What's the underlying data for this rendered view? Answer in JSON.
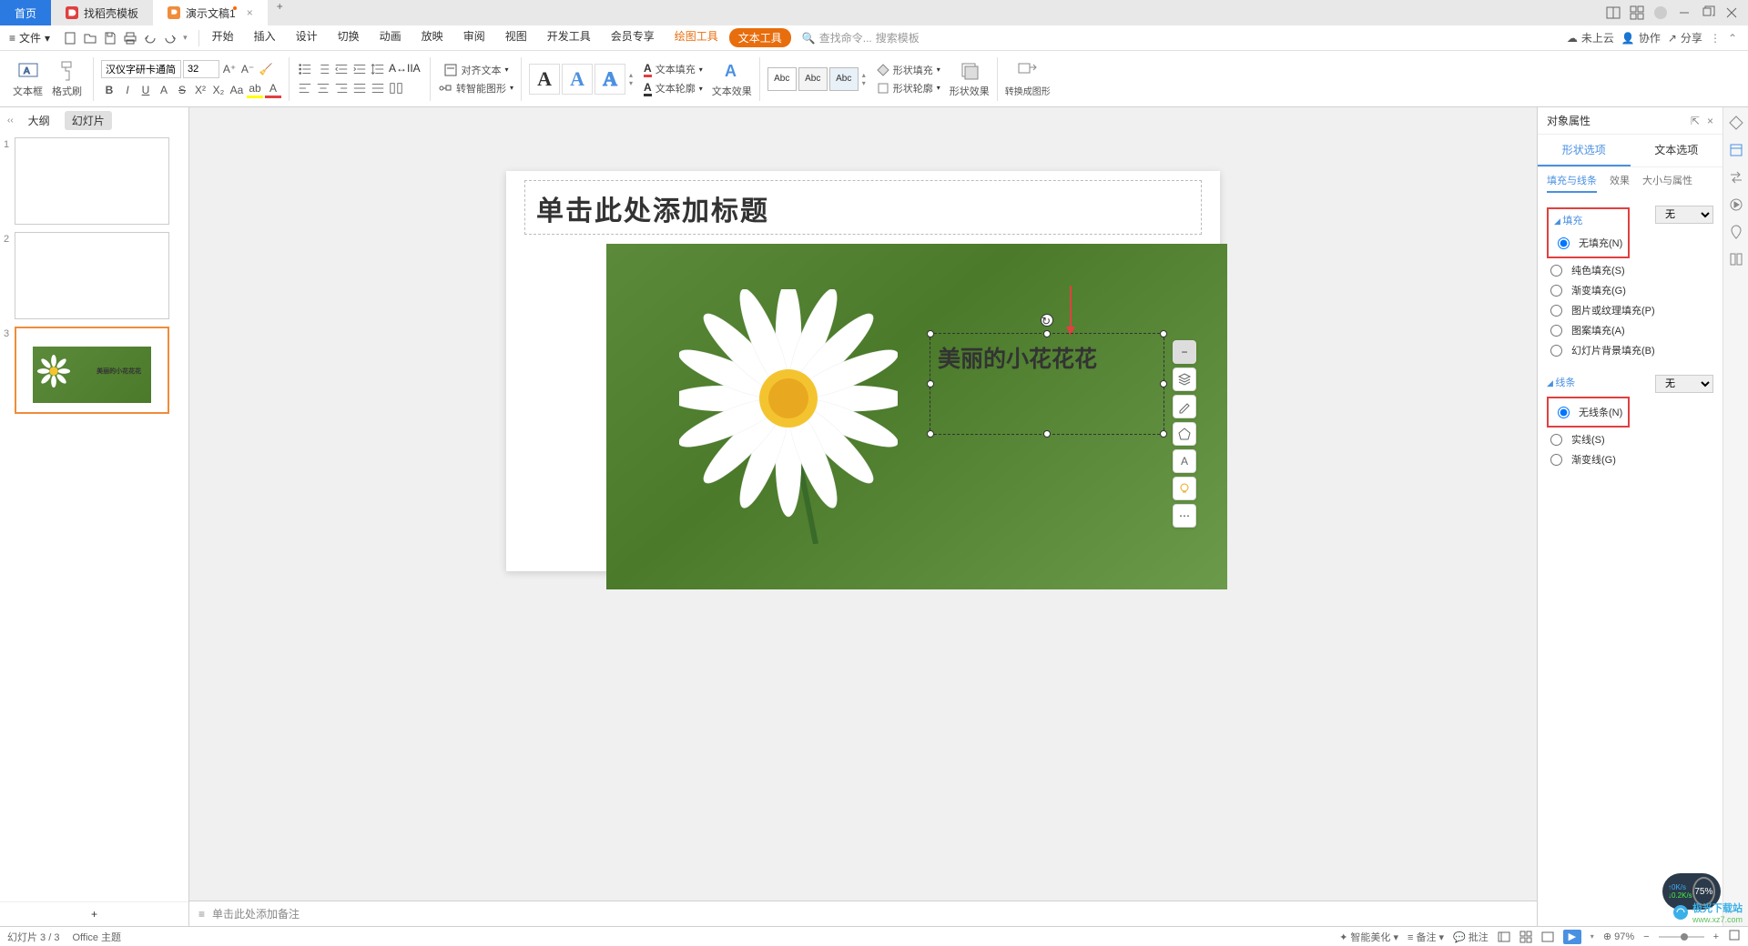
{
  "title_bar": {
    "home": "首页",
    "tab1": "找稻壳模板",
    "tab2": "演示文稿1"
  },
  "menu": {
    "file": "文件",
    "items": [
      "开始",
      "插入",
      "设计",
      "切换",
      "动画",
      "放映",
      "审阅",
      "视图",
      "开发工具",
      "会员专享",
      "绘图工具",
      "文本工具"
    ],
    "search1": "查找命令...",
    "search2": "搜索模板"
  },
  "menu_right": {
    "cloud": "未上云",
    "collab": "协作",
    "share": "分享"
  },
  "ribbon": {
    "textbox": "文本框",
    "format_painter": "格式刷",
    "font_name": "汉仪字研卡通简",
    "font_size": "32",
    "align_text": "对齐文本",
    "smart_shape": "转智能图形",
    "text_fill": "文本填充",
    "text_outline": "文本轮廓",
    "text_effects": "文本效果",
    "abc": "Abc",
    "shape_fill": "形状填充",
    "shape_outline": "形状轮廓",
    "shape_effects": "形状效果",
    "to_picture": "转换成图形"
  },
  "left_panel": {
    "outline": "大纲",
    "slides": "幻灯片"
  },
  "slide": {
    "title_placeholder": "单击此处添加标题",
    "textbox": "美丽的小花花花"
  },
  "notes": "单击此处添加备注",
  "props": {
    "title": "对象属性",
    "tab_shape": "形状选项",
    "tab_text": "文本选项",
    "sub_fill": "填充与线条",
    "sub_effect": "效果",
    "sub_size": "大小与属性",
    "fill_section": "填充",
    "line_section": "线条",
    "no_fill": "无填充(N)",
    "solid_fill": "纯色填充(S)",
    "gradient_fill": "渐变填充(G)",
    "picture_fill": "图片或纹理填充(P)",
    "pattern_fill": "图案填充(A)",
    "bg_fill": "幻灯片背景填充(B)",
    "no_line": "无线条(N)",
    "solid_line": "实线(S)",
    "gradient_line": "渐变线(G)",
    "combo_none": "无"
  },
  "status": {
    "slide": "幻灯片 3 / 3",
    "theme": "Office 主题",
    "beautify": "智能美化",
    "notes": "备注",
    "comments": "批注",
    "zoom": "97%"
  },
  "net": {
    "up": "0K/s",
    "down": "0.2K/s",
    "pct": "75%"
  },
  "watermark": {
    "brand": "极光下载站",
    "url": "www.xz7.com"
  }
}
